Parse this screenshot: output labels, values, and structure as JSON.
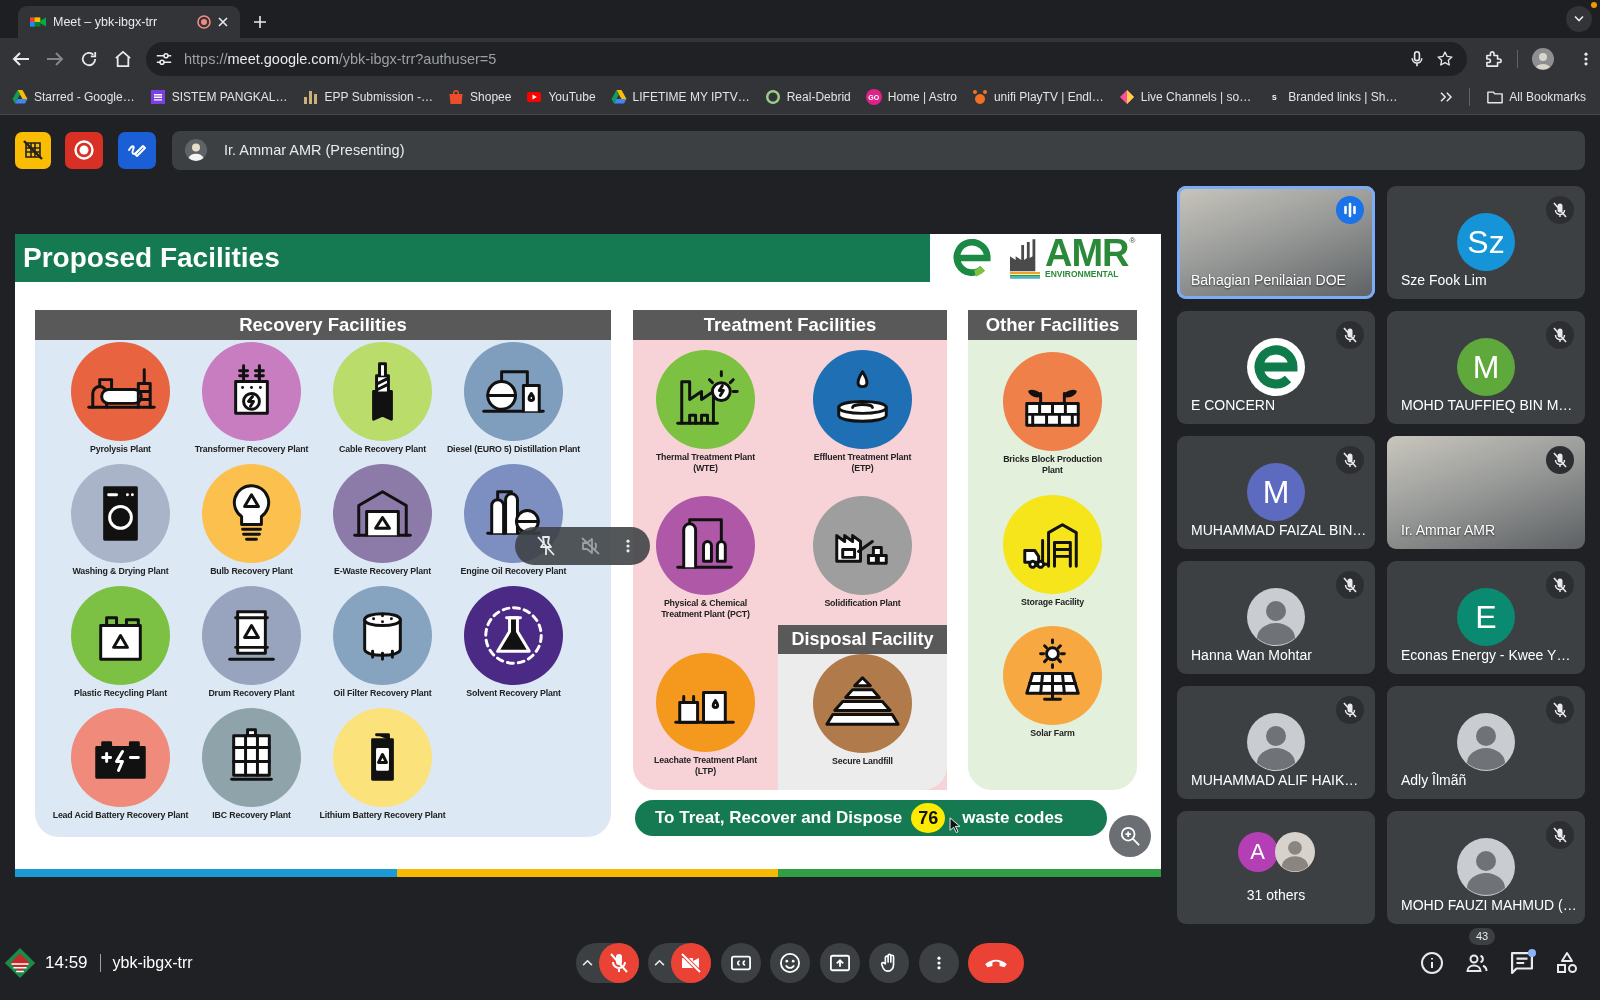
{
  "browser": {
    "tabs": [
      {
        "title": "Meet – ybk-ibgx-trr",
        "selected": true,
        "recording": true
      }
    ],
    "forward_disabled": true,
    "address": "https://**meet.google.com**/ybk-ibgx-trr?authuser=5",
    "bookmarks": [
      {
        "label": "Starred - Google…"
      },
      {
        "label": "SISTEM PANGKAL…"
      },
      {
        "label": "EPP Submission -…"
      },
      {
        "label": "Shopee"
      },
      {
        "label": "YouTube"
      },
      {
        "label": "LIFETIME MY IPTV…"
      },
      {
        "label": "Real-Debrid"
      },
      {
        "label": "Home | Astro",
        "icon_text": "GO"
      },
      {
        "label": "unifi PlayTV | Endl…"
      },
      {
        "label": "Live Channels | so…"
      },
      {
        "label": "Branded links | Sh…",
        "icon_text": "S"
      }
    ],
    "all_bookmarks": "All Bookmarks"
  },
  "meet": {
    "presenter": "Ir. Ammar AMR (Presenting)",
    "slide": {
      "title": "Proposed Facilities",
      "logo": {
        "name": "AMR",
        "tagline": "ENVIRONMENTAL",
        "mark": "®"
      },
      "recovery": {
        "title": "Recovery Facilities",
        "items": [
          {
            "label": "Pyrolysis Plant",
            "color": "#e8633f"
          },
          {
            "label": "Transformer Recovery Plant",
            "color": "#c77dc0"
          },
          {
            "label": "Cable Recovery Plant",
            "color": "#b9dc6a"
          },
          {
            "label": "Diesel (EURO 5) Distillation Plant",
            "color": "#7f9dbd"
          },
          {
            "label": "Washing & Drying Plant",
            "color": "#aab4c8"
          },
          {
            "label": "Bulb Recovery Plant",
            "color": "#fbc04d"
          },
          {
            "label": "E-Waste Recovery Plant",
            "color": "#8c7aa8"
          },
          {
            "label": "Engine Oil Recovery Plant",
            "color": "#7d8fc0"
          },
          {
            "label": "Plastic Recycling Plant",
            "color": "#7cc144"
          },
          {
            "label": "Drum Recovery Plant",
            "color": "#98a3bd"
          },
          {
            "label": "Oil Filter Recovery Plant",
            "color": "#86a3c0"
          },
          {
            "label": "Solvent Recovery Plant",
            "color": "#4b2a86"
          },
          {
            "label": "Lead Acid Battery Recovery Plant",
            "color": "#f08a7a"
          },
          {
            "label": "IBC Recovery Plant",
            "color": "#8fa3ab"
          },
          {
            "label": "Lithium Battery Recovery Plant",
            "color": "#fbe27a"
          }
        ]
      },
      "treatment": {
        "title": "Treatment Facilities",
        "items": [
          {
            "label": "Thermal Treatment Plant (WTE)",
            "color": "#7cc142"
          },
          {
            "label": "Effluent Treatment Plant (ETP)",
            "color": "#1f6fb4"
          },
          {
            "label": "Physical & Chemical Treatment Plant (PCT)",
            "color": "#b058a8"
          },
          {
            "label": "Solidification Plant",
            "color": "#9e9e9e"
          },
          {
            "label": "Leachate Treatment Plant (LTP)",
            "color": "#f5981e"
          }
        ]
      },
      "disposal": {
        "title": "Disposal Facility",
        "items": [
          {
            "label": "Secure Landfill",
            "color": "#b07a4a"
          }
        ]
      },
      "other": {
        "title": "Other Facilities",
        "items": [
          {
            "label": "Bricks Block Production Plant",
            "color": "#f0804a"
          },
          {
            "label": "Storage Facility",
            "color": "#f5e51a"
          },
          {
            "label": "Solar Farm",
            "color": "#f7a840"
          }
        ]
      },
      "banner": {
        "text": "To Treat, Recover and Dispose",
        "count": "76",
        "tail": "waste codes"
      }
    },
    "participants": [
      {
        "name": "Bahagian Penilaian DOE",
        "kind": "video",
        "speaking": true,
        "muted": false
      },
      {
        "name": "Sze Fook Lim",
        "kind": "initials",
        "initials": "Sz",
        "color": "#1595d8",
        "speaking": false,
        "muted": true
      },
      {
        "name": "E CONCERN",
        "kind": "logo",
        "speaking": false,
        "muted": true
      },
      {
        "name": "MOHD TAUFFIEQ BIN M…",
        "kind": "initials",
        "initials": "M",
        "color": "#5fa83c",
        "speaking": false,
        "muted": true
      },
      {
        "name": "MUHAMMAD FAIZAL BIN…",
        "kind": "initials",
        "initials": "M",
        "color": "#5c6bc0",
        "speaking": false,
        "muted": true
      },
      {
        "name": "Ir. Ammar AMR",
        "kind": "video",
        "speaking": false,
        "muted": true
      },
      {
        "name": "Hanna Wan Mohtar",
        "kind": "photo",
        "speaking": false,
        "muted": true
      },
      {
        "name": "Econas Energy - Kwee Y…",
        "kind": "initials",
        "initials": "E",
        "color": "#0b8a72",
        "speaking": false,
        "muted": true
      },
      {
        "name": "MUHAMMAD ALIF HAIK…",
        "kind": "photo",
        "speaking": false,
        "muted": true
      },
      {
        "name": "Adly Îlmãñ",
        "kind": "photo",
        "speaking": false,
        "muted": true
      },
      {
        "name": "31 others",
        "kind": "group",
        "speaking": false,
        "muted": false,
        "avatars": [
          {
            "kind": "initials",
            "initials": "A",
            "color": "#b43fb5"
          },
          {
            "kind": "photo"
          }
        ]
      },
      {
        "name": "MOHD FAUZI MAHMUD (…",
        "kind": "photo",
        "speaking": false,
        "muted": true
      }
    ],
    "call": {
      "time": "14:59",
      "code": "ybk-ibgx-trr",
      "mic_on": false,
      "camera_on": false,
      "people_count": "43",
      "chat_unread": true
    }
  }
}
